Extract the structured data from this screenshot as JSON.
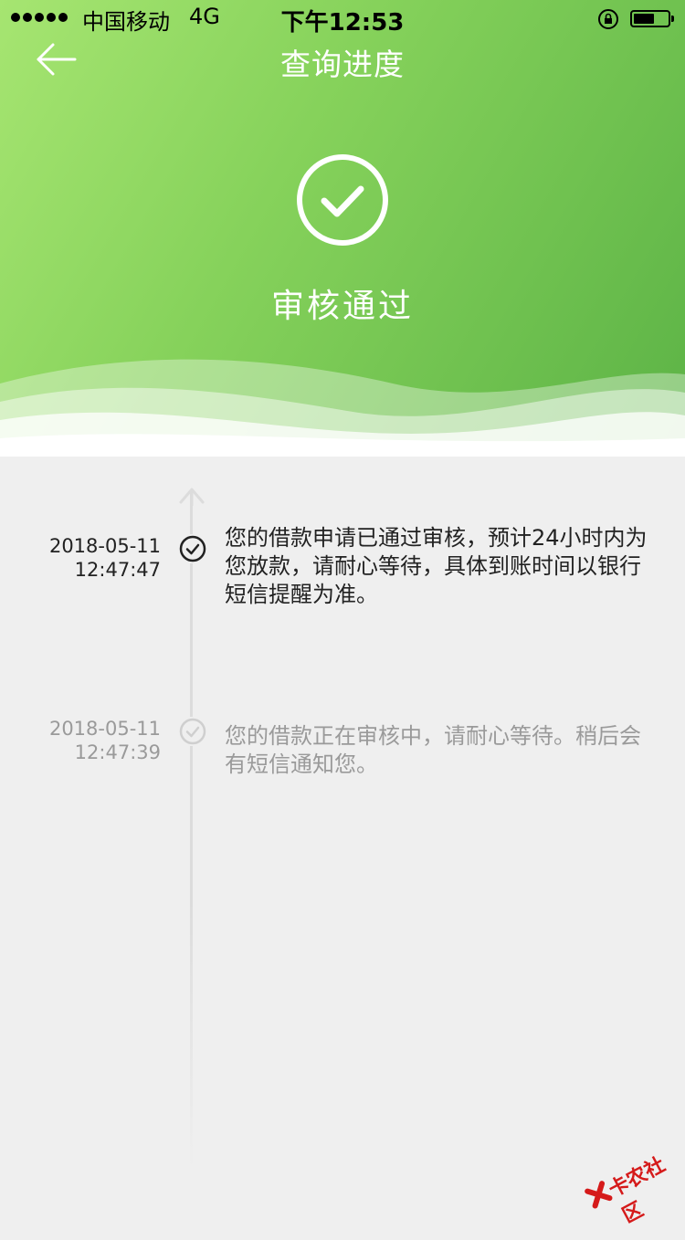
{
  "status_bar": {
    "carrier": "中国移动",
    "network": "4G",
    "time": "下午12:53"
  },
  "nav": {
    "title": "查询进度",
    "back_icon": "arrow-left-icon"
  },
  "status": {
    "icon": "check-circle-icon",
    "label": "审核通过"
  },
  "timeline": [
    {
      "date": "2018-05-11",
      "time": "12:47:47",
      "text": "您的借款申请已通过审核，预计24小时内为您放款，请耐心等待，具体到账时间以银行短信提醒为准。"
    },
    {
      "date": "2018-05-11",
      "time": "12:47:39",
      "text": "您的借款正在审核中，请耐心等待。稍后会有短信通知您。"
    }
  ],
  "watermark": {
    "text": "卡农社区"
  },
  "colors": {
    "header_start": "#a6e571",
    "header_end": "#5cb346",
    "background": "#efefef",
    "active_text": "#222222",
    "inactive_text": "#9a9a9a"
  }
}
